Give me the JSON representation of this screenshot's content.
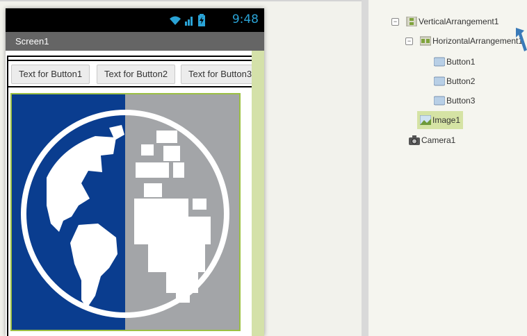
{
  "phone": {
    "status_time": "9:48",
    "screen_title": "Screen1",
    "buttons": [
      "Text for Button1",
      "Text for Button2",
      "Text for Button3"
    ]
  },
  "tree": {
    "vertical_arrangement": "VerticalArrangement1",
    "horizontal_arrangement": "HorizontalArrangement1",
    "button1": "Button1",
    "button2": "Button2",
    "button3": "Button3",
    "image1": "Image1",
    "camera1": "Camera1"
  },
  "colors": {
    "status_time": "#2aa3d6",
    "titlebar": "#656565",
    "image_border": "#9cc043",
    "globe_blue": "#0a3d8f",
    "globe_gray": "#a3a5a8",
    "selection": "#d5e3a4"
  }
}
